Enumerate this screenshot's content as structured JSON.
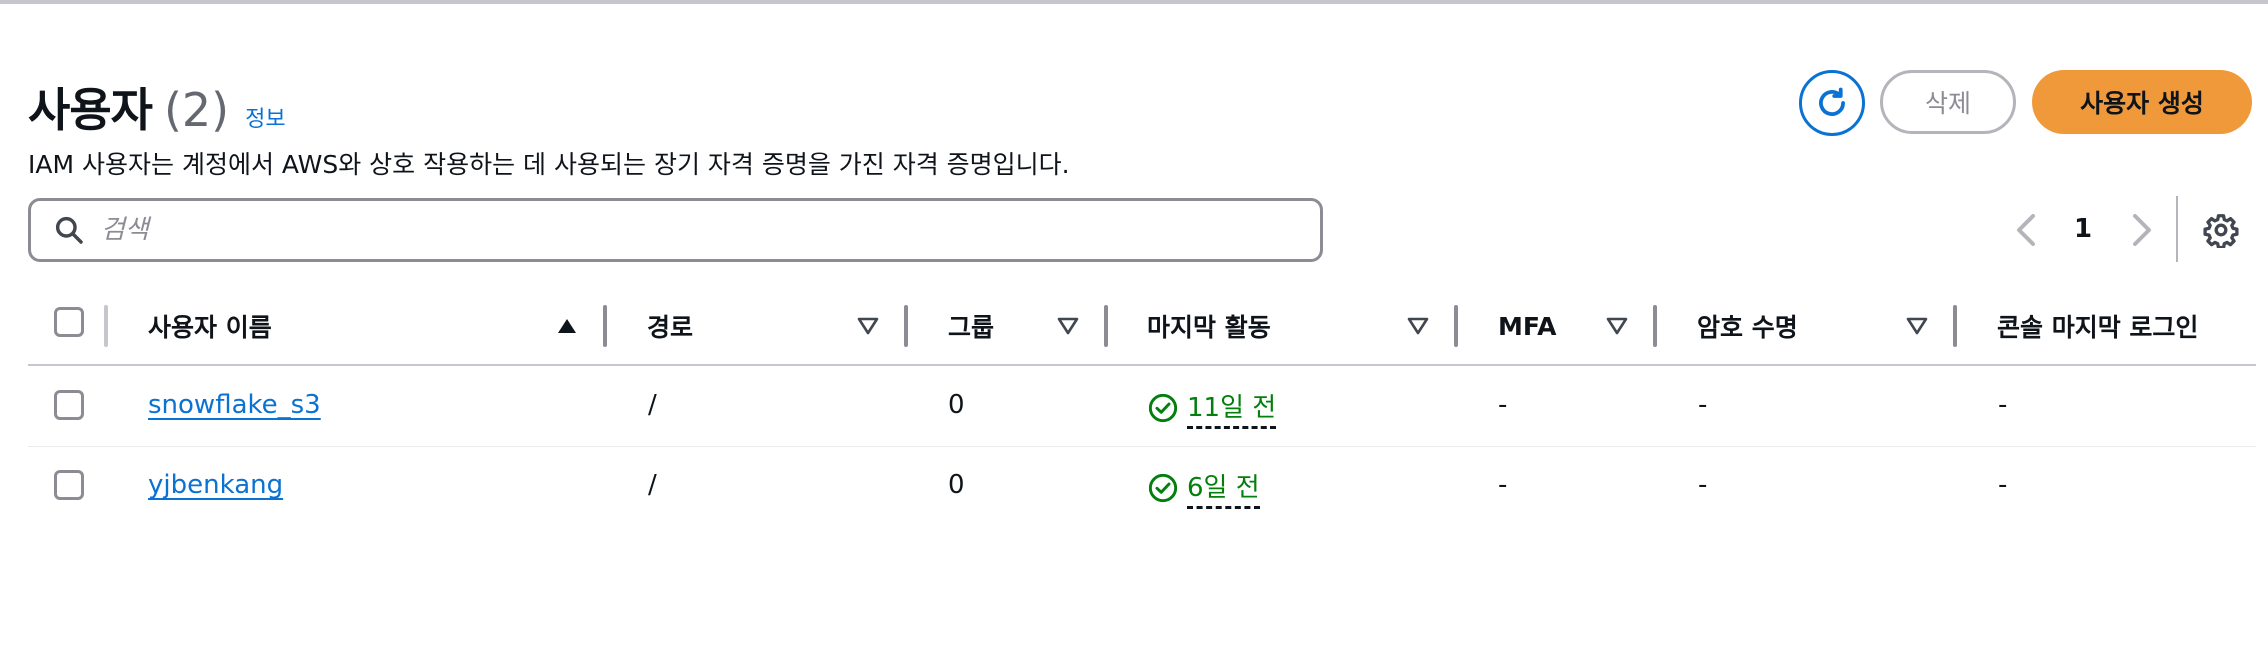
{
  "header": {
    "title": "사용자",
    "count": "(2)",
    "info_link": "정보",
    "description": "IAM 사용자는 계정에서 AWS와 상호 작용하는 데 사용되는 장기 자격 증명을 가진 자격 증명입니다."
  },
  "actions": {
    "delete_label": "삭제",
    "create_label": "사용자 생성"
  },
  "search": {
    "placeholder": "검색",
    "value": ""
  },
  "pagination": {
    "current_page": "1"
  },
  "table": {
    "columns": [
      {
        "label": "사용자 이름",
        "sort": "ascending"
      },
      {
        "label": "경로",
        "sort": "none"
      },
      {
        "label": "그룹",
        "sort": "none"
      },
      {
        "label": "마지막 활동",
        "sort": "none"
      },
      {
        "label": "MFA",
        "sort": "none"
      },
      {
        "label": "암호 수명",
        "sort": "none"
      },
      {
        "label": "콘솔 마지막 로그인",
        "sort": "none"
      }
    ],
    "rows": [
      {
        "user_name": "snowflake_s3",
        "path": "/",
        "groups": "0",
        "last_activity": "11일 전",
        "mfa": "-",
        "password_age": "-",
        "console_last_signin": "-"
      },
      {
        "user_name": "yjbenkang",
        "path": "/",
        "groups": "0",
        "last_activity": "6일 전",
        "mfa": "-",
        "password_age": "-",
        "console_last_signin": "-"
      }
    ]
  },
  "colors": {
    "link": "#0972d3",
    "primary_button": "#f0993a",
    "success": "#037f0c"
  },
  "icons": [
    "refresh-icon",
    "search-icon",
    "chevron-left-icon",
    "chevron-right-icon",
    "gear-icon",
    "sort-ascending-icon",
    "sort-icon",
    "check-circle-icon"
  ]
}
